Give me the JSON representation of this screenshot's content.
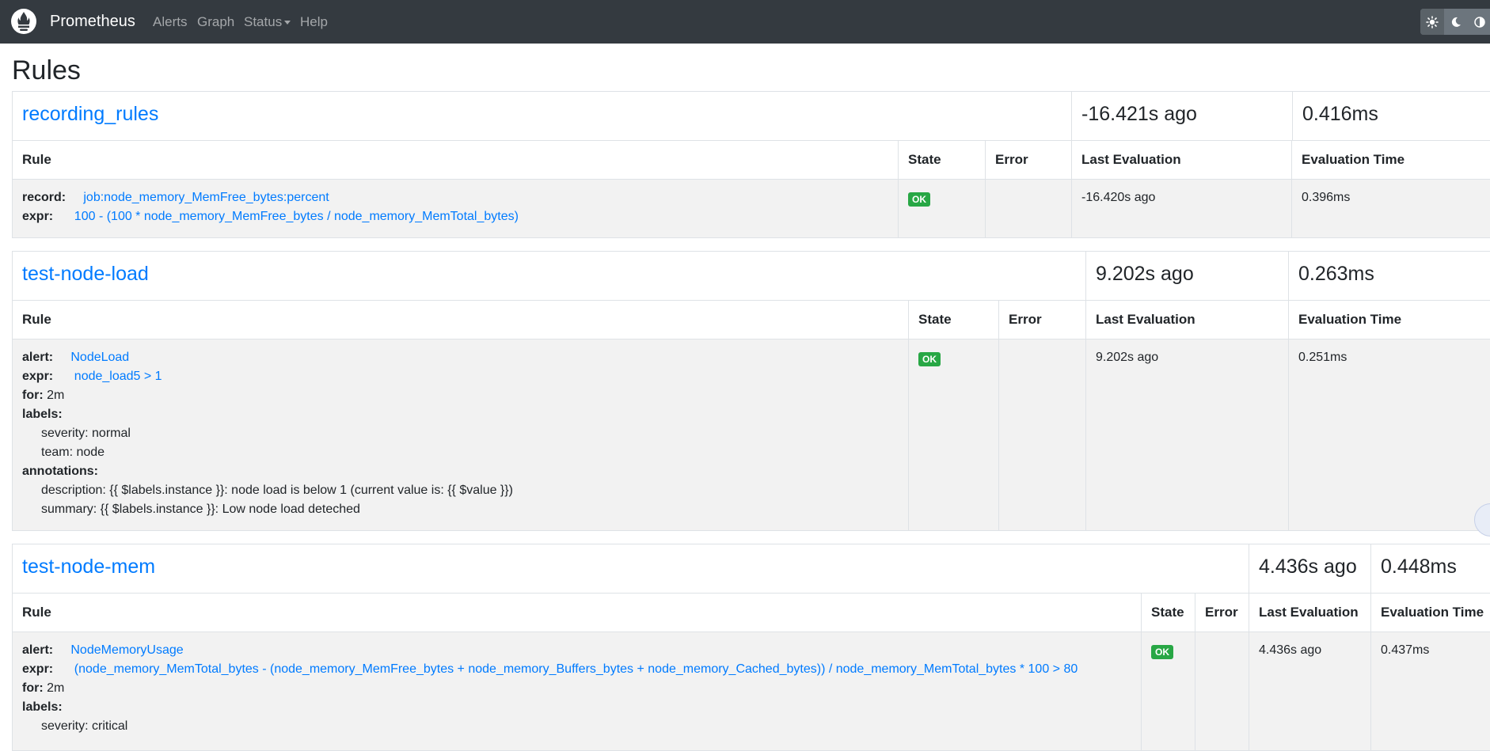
{
  "nav": {
    "brand": "Prometheus",
    "links": [
      "Alerts",
      "Graph",
      "Status",
      "Help"
    ],
    "theme_icons": [
      "sun-icon",
      "moon-icon",
      "contrast-icon"
    ]
  },
  "page": {
    "title": "Rules"
  },
  "table_headers": {
    "rule": "Rule",
    "state": "State",
    "error": "Error",
    "last_eval": "Last Evaluation",
    "eval_time": "Evaluation Time"
  },
  "groups": [
    {
      "name": "recording_rules",
      "last_eval": "-16.421s ago",
      "eval_time": "0.416ms",
      "rule": {
        "record_key": "record:",
        "record": "job:node_memory_MemFree_bytes:percent",
        "expr_key": "expr:",
        "expr": "100 - (100 * node_memory_MemFree_bytes / node_memory_MemTotal_bytes)",
        "state": "OK",
        "error": "",
        "last_eval": "-16.420s ago",
        "eval_time": "0.396ms"
      }
    },
    {
      "name": "test-node-load",
      "last_eval": "9.202s ago",
      "eval_time": "0.263ms",
      "rule": {
        "alert_key": "alert:",
        "alert": "NodeLoad",
        "expr_key": "expr:",
        "expr": "node_load5 > 1",
        "for_key": "for:",
        "for": "2m",
        "labels_key": "labels:",
        "labels": [
          "severity: normal",
          "team: node"
        ],
        "annotations_key": "annotations:",
        "annotations": [
          "description: {{ $labels.instance }}: node load is below 1 (current value is: {{ $value }})",
          "summary: {{ $labels.instance }}: Low node load deteched"
        ],
        "state": "OK",
        "error": "",
        "last_eval": "9.202s ago",
        "eval_time": "0.251ms"
      }
    },
    {
      "name": "test-node-mem",
      "last_eval": "4.436s ago",
      "eval_time": "0.448ms",
      "rule": {
        "alert_key": "alert:",
        "alert": "NodeMemoryUsage",
        "expr_key": "expr:",
        "expr": "(node_memory_MemTotal_bytes - (node_memory_MemFree_bytes + node_memory_Buffers_bytes + node_memory_Cached_bytes)) / node_memory_MemTotal_bytes * 100 > 80",
        "for_key": "for:",
        "for": "2m",
        "labels_key": "labels:",
        "labels": [
          "severity: critical"
        ],
        "state": "OK",
        "error": "",
        "last_eval": "4.436s ago",
        "eval_time": "0.437ms"
      }
    }
  ]
}
